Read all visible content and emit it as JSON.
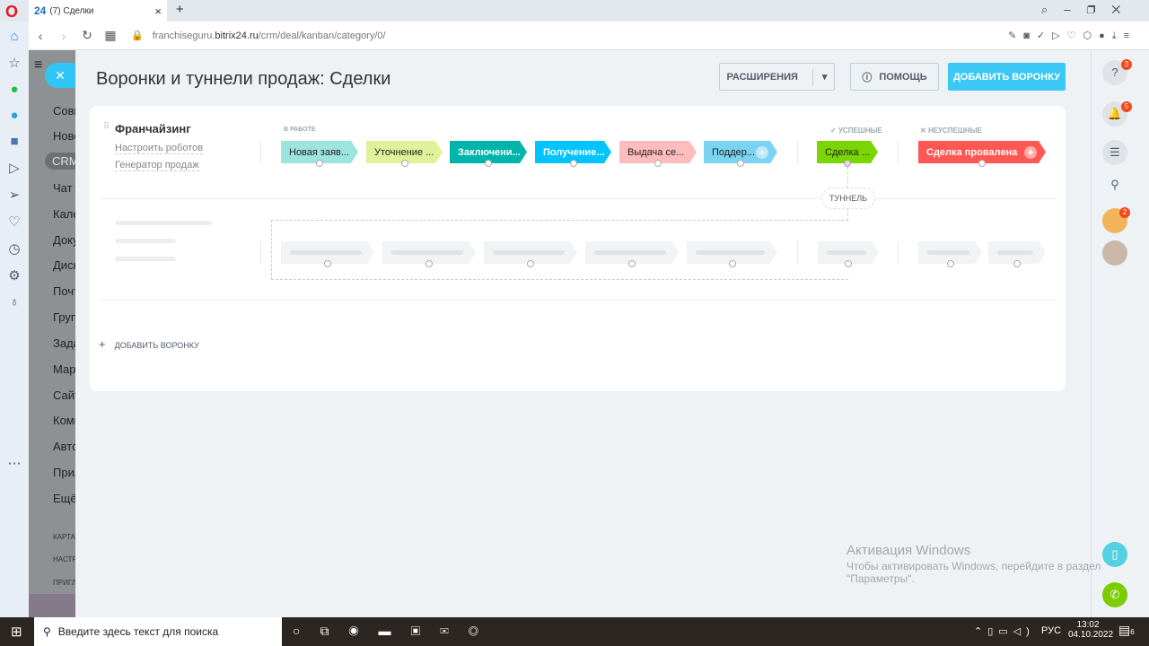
{
  "browser": {
    "tab_title_logo": "24",
    "tab_title": "(7) Сделки",
    "url_host": "franchiseguru.",
    "url_domain": "bitrix24.ru",
    "url_path": "/crm/deal/kanban/category/0/"
  },
  "left_menu": {
    "items": [
      "Совм",
      "Ново",
      "CRM",
      "Чат и",
      "Кале",
      "Доку",
      "Диск",
      "Почт",
      "Груп",
      "Зада",
      "Мар",
      "Сайт",
      "Комп",
      "Авто",
      "Прил",
      "Ещё"
    ],
    "small_items": [
      "КАРТА",
      "НАСТР",
      "ПРИГЛ"
    ]
  },
  "page": {
    "title": "Воронки и туннели продаж: Сделки",
    "extensions_label": "РАСШИРЕНИЯ",
    "help_label": "ПОМОЩЬ",
    "add_funnel_label": "ДОБАВИТЬ ВОРОНКУ"
  },
  "funnel": {
    "name": "Франчайзинг",
    "robots_link": "Настроить роботов",
    "generator_link": "Генератор продаж",
    "group_in_work": "В РАБОТЕ",
    "group_success": "УСПЕШНЫЕ",
    "group_fail": "НЕУСПЕШНЫЕ",
    "stages": [
      {
        "label": "Новая заяв...",
        "color": "#9de3de"
      },
      {
        "label": "Уточнение ...",
        "color": "#dff199"
      },
      {
        "label": "Заключени...",
        "color": "#00b4ac"
      },
      {
        "label": "Получение...",
        "color": "#00c4fb"
      },
      {
        "label": "Выдача се...",
        "color": "#ffbcbc"
      },
      {
        "label": "Поддер...",
        "color": "#7bd3f2"
      }
    ],
    "success_stage": {
      "label": "Сделка ...",
      "color": "#7bd500"
    },
    "fail_stage": {
      "label": "Сделка провалена",
      "color": "#ff5752"
    },
    "tunnel_label": "ТУННЕЛЬ"
  },
  "add_funnel_link": "ДОБАВИТЬ ВОРОНКУ",
  "right_panel": {
    "help_badge": "3",
    "notif_badge": "5",
    "avatar_badge": "2"
  },
  "windows_activation": {
    "title": "Активация Windows",
    "line1": "Чтобы активировать Windows, перейдите в раздел",
    "line2": "\"Параметры\"."
  },
  "taskbar": {
    "search_placeholder": "Введите здесь текст для поиска",
    "lang": "РУС",
    "time": "13:02",
    "date": "04.10.2022",
    "notif_count": "6"
  }
}
